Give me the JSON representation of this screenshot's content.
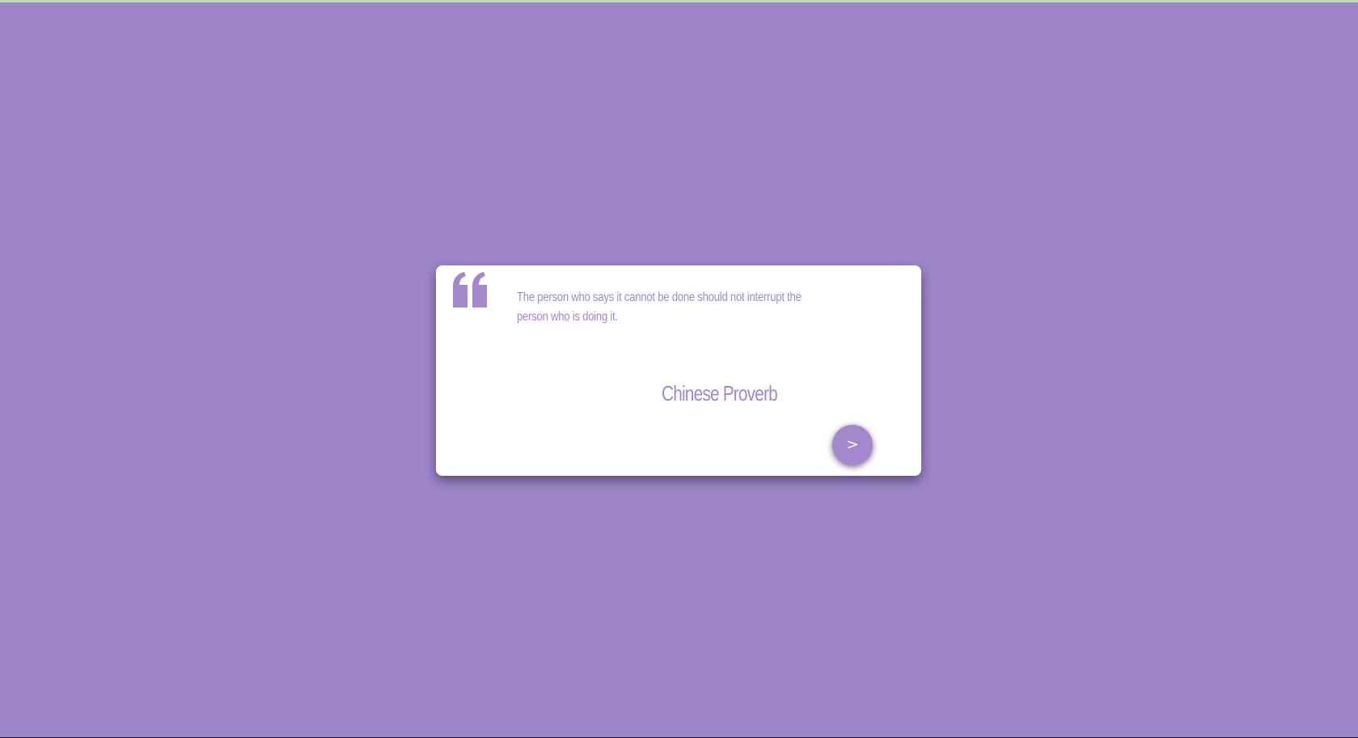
{
  "colors": {
    "background": "#9e86c9",
    "accent": "#a487cc",
    "card": "#ffffff",
    "top_strip": "#b8dcb4",
    "button_text": "#ffffff"
  },
  "quote": {
    "icon": "quote-open-icon",
    "text": "The person who says it cannot be done should not interrupt the person who is doing it.",
    "author": "Chinese Proverb"
  },
  "next_button": {
    "label": ">"
  }
}
